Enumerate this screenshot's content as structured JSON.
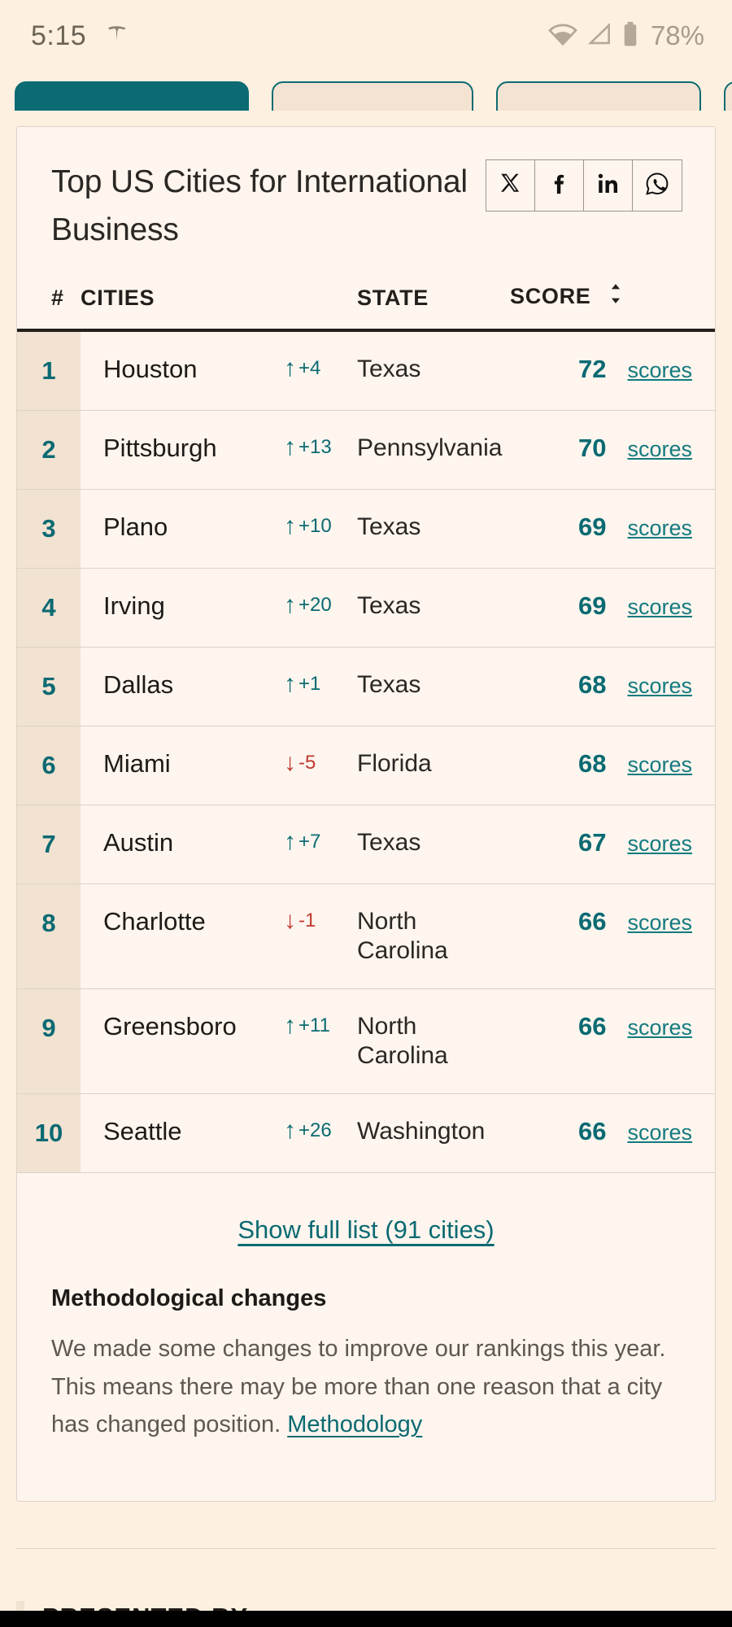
{
  "statusbar": {
    "time": "5:15",
    "carrier_icon": "tesla-icon",
    "wifi_icon": "wifi-icon",
    "signal_icon": "signal-icon",
    "battery_icon": "battery-icon",
    "battery_text": "78%"
  },
  "chips": [
    {
      "label": "",
      "active": true
    },
    {
      "label": "",
      "active": false
    },
    {
      "label": "",
      "active": false
    },
    {
      "label": "",
      "active": false
    }
  ],
  "card": {
    "title": "Top US Cities for International Business",
    "share": [
      {
        "name": "share-x-button",
        "icon": "x-twitter-icon"
      },
      {
        "name": "share-facebook-button",
        "icon": "facebook-icon"
      },
      {
        "name": "share-linkedin-button",
        "icon": "linkedin-icon"
      },
      {
        "name": "share-whatsapp-button",
        "icon": "whatsapp-icon"
      }
    ],
    "table": {
      "headers": {
        "rank": "#",
        "cities": "CITIES",
        "state": "STATE",
        "score": "SCORE"
      },
      "score_link_label": "scores",
      "rows": [
        {
          "rank": "1",
          "city": "Houston",
          "delta": "+4",
          "dir": "up",
          "state": "Texas",
          "score": "72"
        },
        {
          "rank": "2",
          "city": "Pittsburgh",
          "delta": "+13",
          "dir": "up",
          "state": "Pennsylvania",
          "score": "70"
        },
        {
          "rank": "3",
          "city": "Plano",
          "delta": "+10",
          "dir": "up",
          "state": "Texas",
          "score": "69"
        },
        {
          "rank": "4",
          "city": "Irving",
          "delta": "+20",
          "dir": "up",
          "state": "Texas",
          "score": "69"
        },
        {
          "rank": "5",
          "city": "Dallas",
          "delta": "+1",
          "dir": "up",
          "state": "Texas",
          "score": "68"
        },
        {
          "rank": "6",
          "city": "Miami",
          "delta": "-5",
          "dir": "down",
          "state": "Florida",
          "score": "68"
        },
        {
          "rank": "7",
          "city": "Austin",
          "delta": "+7",
          "dir": "up",
          "state": "Texas",
          "score": "67"
        },
        {
          "rank": "8",
          "city": "Charlotte",
          "delta": "-1",
          "dir": "down",
          "state": "North Carolina",
          "score": "66"
        },
        {
          "rank": "9",
          "city": "Greensboro",
          "delta": "+11",
          "dir": "up",
          "state": "North Carolina",
          "score": "66"
        },
        {
          "rank": "10",
          "city": "Seattle",
          "delta": "+26",
          "dir": "up",
          "state": "Washington",
          "score": "66"
        }
      ]
    },
    "full_list_link": "Show full list (91 cities)",
    "methodology": {
      "title": "Methodological changes",
      "body": "We made some changes to improve our rankings this year. This means there may be more than one reason that a city has changed position. ",
      "link": "Methodology"
    }
  },
  "footer": {
    "presented_by": "PRESENTED BY"
  },
  "colors": {
    "page_bg": "#fdf0e0",
    "card_bg": "#fdf5ee",
    "accent_teal": "#0b6a72",
    "rank_bg": "#f2e2d2",
    "down_red": "#c0392f",
    "text_dark": "#1d1a17"
  }
}
